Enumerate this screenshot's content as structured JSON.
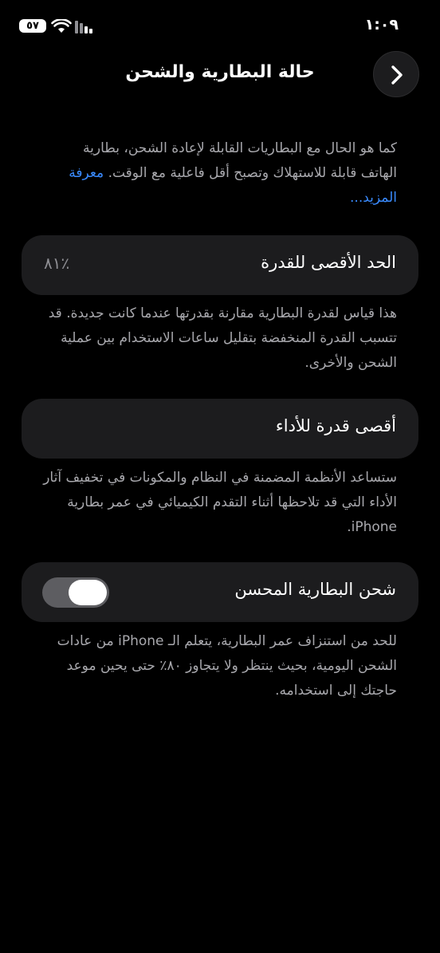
{
  "status_bar": {
    "time": "١:٠٩",
    "battery_level": "٥٧",
    "wifi_icon": "wifi-icon",
    "signal_icon": "cellular-signal-icon"
  },
  "nav": {
    "title": "حالة البطارية والشحن",
    "back_icon": "chevron-icon"
  },
  "intro": {
    "text": "كما هو الحال مع البطاريات القابلة لإعادة الشحن، بطارية الهاتف قابلة للاستهلاك وتصبح أقل فاعلية مع الوقت.",
    "learn_more": "معرفة المزيد..."
  },
  "maximum_capacity": {
    "label": "الحد الأقصى للقدرة",
    "value": "٪٨١",
    "description": "هذا قياس لقدرة البطارية مقارنة بقدرتها عندما كانت جديدة. قد تتسبب القدرة المنخفضة بتقليل ساعات الاستخدام بين عملية الشحن والأخرى."
  },
  "peak_performance": {
    "label": "أقصى قدرة للأداء",
    "description": "ستساعد الأنظمة المضمنة في النظام والمكونات في تخفيف آثار الأداء التي قد تلاحظها أثناء التقدم الكيميائي في عمر بطارية iPhone."
  },
  "optimized_charging": {
    "label": "شحن البطارية المحسن",
    "enabled": true,
    "description": "للحد من استنزاف عمر البطارية، يتعلم الـ iPhone من عادات الشحن اليومية، بحيث ينتظر ولا يتجاوز ٨٠٪ حتى يحين موعد حاجتك إلى استخدامه."
  },
  "colors": {
    "background": "#000000",
    "card": "#1c1c1e",
    "secondary_text": "#a8a8ad",
    "link": "#3a8bff",
    "toggle_track": "#5d5d61"
  }
}
